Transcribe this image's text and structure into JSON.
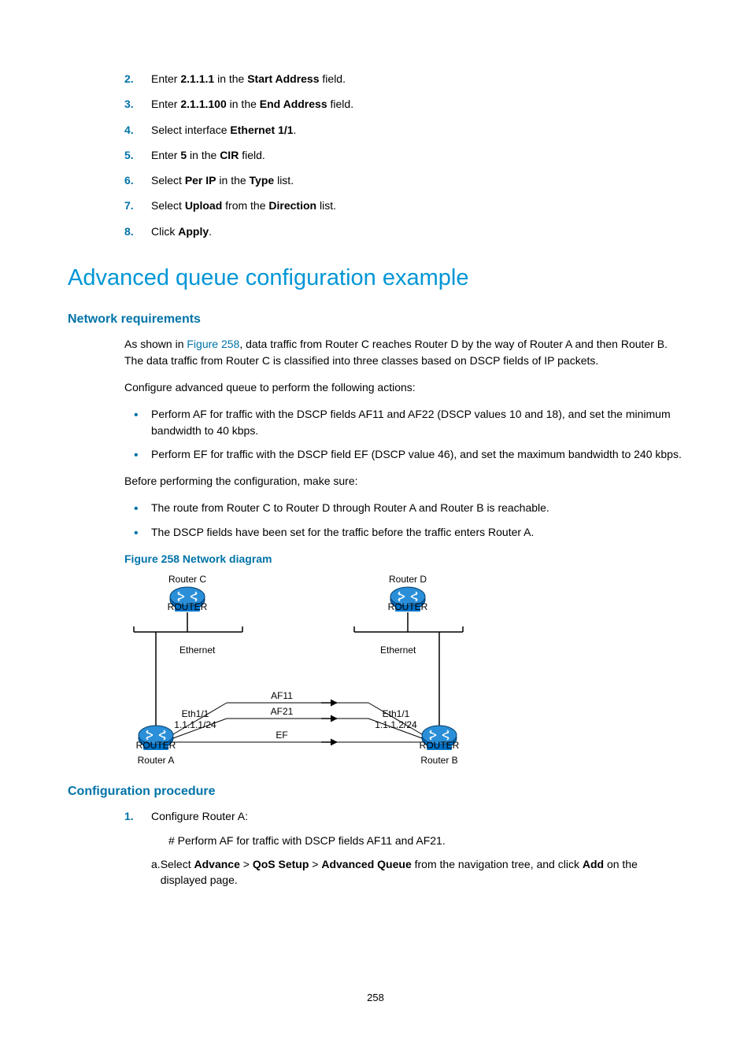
{
  "steps_top": [
    {
      "n": "2.",
      "parts": [
        {
          "t": "Enter "
        },
        {
          "t": "2.1.1.1",
          "b": true
        },
        {
          "t": " in the "
        },
        {
          "t": "Start Address",
          "b": true
        },
        {
          "t": " field."
        }
      ]
    },
    {
      "n": "3.",
      "parts": [
        {
          "t": "Enter "
        },
        {
          "t": "2.1.1.100",
          "b": true
        },
        {
          "t": " in the "
        },
        {
          "t": "End Address",
          "b": true
        },
        {
          "t": " field."
        }
      ]
    },
    {
      "n": "4.",
      "parts": [
        {
          "t": "Select interface "
        },
        {
          "t": "Ethernet 1/1",
          "b": true
        },
        {
          "t": "."
        }
      ]
    },
    {
      "n": "5.",
      "parts": [
        {
          "t": "Enter "
        },
        {
          "t": "5",
          "b": true
        },
        {
          "t": " in the "
        },
        {
          "t": "CIR",
          "b": true
        },
        {
          "t": " field."
        }
      ]
    },
    {
      "n": "6.",
      "parts": [
        {
          "t": "Select "
        },
        {
          "t": "Per IP",
          "b": true
        },
        {
          "t": " in the "
        },
        {
          "t": "Type",
          "b": true
        },
        {
          "t": " list."
        }
      ]
    },
    {
      "n": "7.",
      "parts": [
        {
          "t": "Select "
        },
        {
          "t": "Upload",
          "b": true
        },
        {
          "t": " from the "
        },
        {
          "t": "Direction",
          "b": true
        },
        {
          "t": " list."
        }
      ]
    },
    {
      "n": "8.",
      "parts": [
        {
          "t": "Click "
        },
        {
          "t": "Apply",
          "b": true
        },
        {
          "t": "."
        }
      ]
    }
  ],
  "h1": "Advanced queue configuration example",
  "h2_req": "Network requirements",
  "req_p1_prefix": "As shown in ",
  "req_p1_link": "Figure 258",
  "req_p1_suffix": ", data traffic from Router C reaches Router D by the way of Router A and then Router B. The data traffic from Router C is classified into three classes based on DSCP fields of IP packets.",
  "req_p2": "Configure advanced queue to perform the following actions:",
  "req_bullets1": [
    "Perform AF for traffic with the DSCP fields AF11 and AF22 (DSCP values 10 and 18), and set the minimum bandwidth to 40 kbps.",
    "Perform EF for traffic with the DSCP field EF (DSCP value 46), and set the maximum bandwidth to 240 kbps."
  ],
  "req_p3": "Before performing the configuration, make sure:",
  "req_bullets2": [
    "The route from Router C to Router D through Router A and Router B is reachable.",
    "The DSCP fields have been set for the traffic before the traffic enters Router A."
  ],
  "figure_title": "Figure 258 Network diagram",
  "diagram": {
    "routerC": "Router C",
    "routerD": "Router D",
    "routerA": "Router A",
    "routerB": "Router B",
    "ethernet": "Ethernet",
    "af11": "AF11",
    "af21": "AF21",
    "ef": "EF",
    "ethA": "Eth1/1",
    "ipA": "1.1.1.1/24",
    "ethB": "Eth1/1",
    "ipB": "1.1.1.2/24",
    "router_label": "ROUTER"
  },
  "h2_proc": "Configuration procedure",
  "proc_step1_num": "1.",
  "proc_step1_text": "Configure Router A:",
  "proc_step1_sub": "# Perform AF for traffic with DSCP fields AF11 and AF21.",
  "proc_a_num": "a.",
  "proc_a_parts": [
    {
      "t": "Select "
    },
    {
      "t": "Advance",
      "b": true
    },
    {
      "t": " > "
    },
    {
      "t": "QoS Setup",
      "b": true
    },
    {
      "t": " > "
    },
    {
      "t": "Advanced Queue",
      "b": true
    },
    {
      "t": " from the navigation tree, and click "
    },
    {
      "t": "Add",
      "b": true
    },
    {
      "t": " on the displayed page."
    }
  ],
  "page_num": "258"
}
